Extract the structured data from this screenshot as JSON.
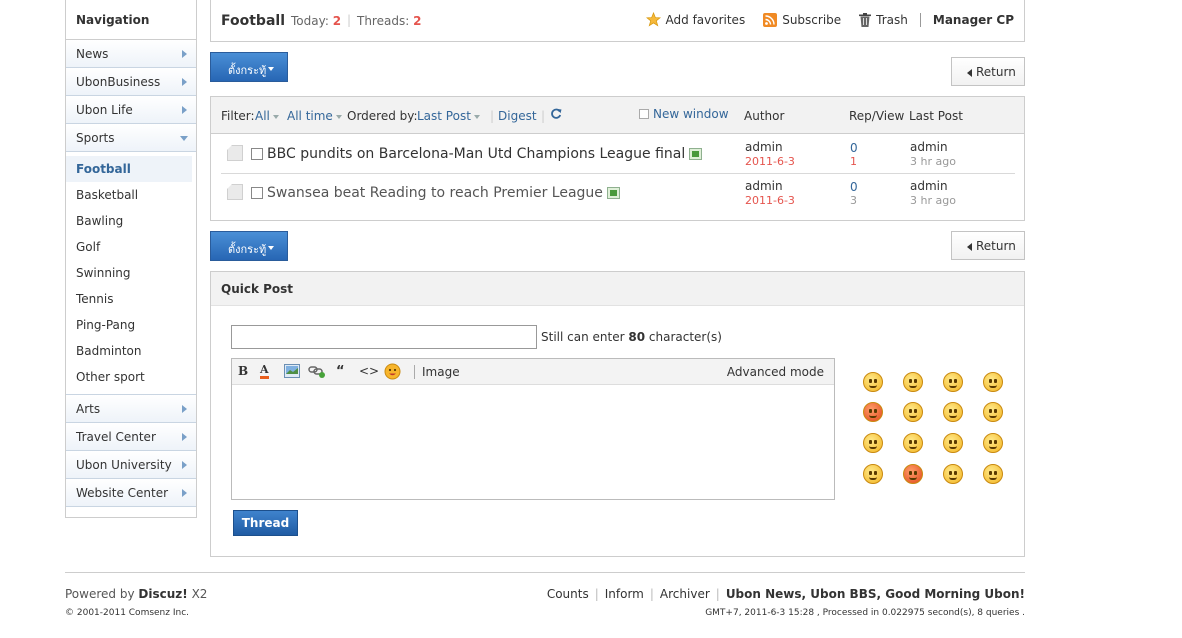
{
  "sidebar": {
    "title": "Navigation",
    "items": [
      {
        "label": "News"
      },
      {
        "label": "UbonBusiness"
      },
      {
        "label": "Ubon Life"
      },
      {
        "label": "Sports"
      }
    ],
    "sports_children": [
      "Football",
      "Basketball",
      "Bawling",
      "Golf",
      "Swinning",
      "Tennis",
      "Ping-Pang",
      "Badminton",
      "Other sport"
    ],
    "items_after": [
      {
        "label": "Arts"
      },
      {
        "label": "Travel Center"
      },
      {
        "label": "Ubon University"
      },
      {
        "label": "Website Center"
      }
    ]
  },
  "header": {
    "title": "Football",
    "today_label": "Today:",
    "today_count": "2",
    "threads_label": "Threads:",
    "threads_count": "2",
    "add_favorites": "Add favorites",
    "subscribe": "Subscribe",
    "trash": "Trash",
    "manager": "Manager CP"
  },
  "toolbar": {
    "post_label": "ตั้งกระทู้",
    "return_label": "Return"
  },
  "filter": {
    "filter_label": "Filter:",
    "all": "All",
    "all_time": "All time",
    "ordered_label": "Ordered by:",
    "last_post": "Last Post",
    "digest": "Digest",
    "new_window": "New window",
    "col_author": "Author",
    "col_rep_view": "Rep/View",
    "col_last_post": "Last Post"
  },
  "threads": [
    {
      "title": "BBC pundits on Barcelona-Man Utd Champions League final",
      "author": "admin",
      "date": "2011-6-3",
      "replies": "0",
      "views": "1",
      "last_author": "admin",
      "last_time": "3 hr ago"
    },
    {
      "title": "Swansea beat Reading to reach Premier League",
      "author": "admin",
      "date": "2011-6-3",
      "replies": "0",
      "views": "3",
      "last_author": "admin",
      "last_time": "3 hr ago"
    }
  ],
  "quick_post": {
    "title": "Quick Post",
    "subject_value": "",
    "hint_prefix": "Still can enter",
    "hint_count": "80",
    "hint_suffix": "character(s)",
    "tool_bold": "B",
    "tool_color": "A",
    "tool_quote": "“",
    "tool_code": "<>",
    "tool_image": "Image",
    "advanced": "Advanced mode",
    "submit": "Thread"
  },
  "footer": {
    "powered_prefix": "Powered by",
    "powered_brand": "Discuz!",
    "powered_version": "X2",
    "copyright": "© 2001-2011 Comsenz Inc.",
    "links": [
      "Counts",
      "Inform",
      "Archiver"
    ],
    "site_name": "Ubon News, Ubon BBS, Good Morning Ubon!",
    "stats": "GMT+7, 2011-6-3 15:28 , Processed in 0.022975 second(s), 8 queries ."
  },
  "colors": {
    "accent_blue": "#336699",
    "count_red": "#e5544d",
    "button_blue": "#2766b4"
  }
}
